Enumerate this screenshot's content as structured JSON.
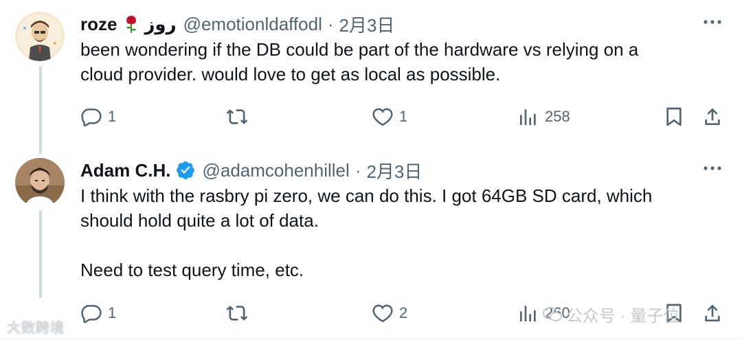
{
  "tweets": [
    {
      "name": "roze",
      "name_suffix": "روز",
      "handle": "@emotionldaffodl",
      "separator": "·",
      "date": "2月3日",
      "text": "been wondering if the DB could be part of the hardware vs relying on a\ncloud provider. would love to get as local as possible.",
      "replies": "1",
      "reposts": "",
      "likes": "1",
      "views": "258"
    },
    {
      "name": "Adam C.H.",
      "handle": "@adamcohenhillel",
      "separator": "·",
      "date": "2月3日",
      "text": "I think with the rasbry pi zero, we can do this. I got 64GB SD card, which\nshould hold quite a lot of data.\n\nNeed to test query time, etc.",
      "replies": "1",
      "reposts": "",
      "likes": "2",
      "views": "260"
    }
  ],
  "watermarks": {
    "left": "大数跨境",
    "right": "公众号 · 量子位"
  },
  "colors": {
    "text": "#0f1419",
    "secondary": "#536471",
    "verified": "#1d9bf0",
    "thread_line": "#cfd9de"
  },
  "icons": {
    "reply": "reply-icon",
    "repost": "repost-icon",
    "like": "heart-icon",
    "views": "views-icon",
    "bookmark": "bookmark-icon",
    "share": "share-icon",
    "more": "more-icon",
    "verified": "verified-badge-icon",
    "rose": "rose-emoji"
  }
}
